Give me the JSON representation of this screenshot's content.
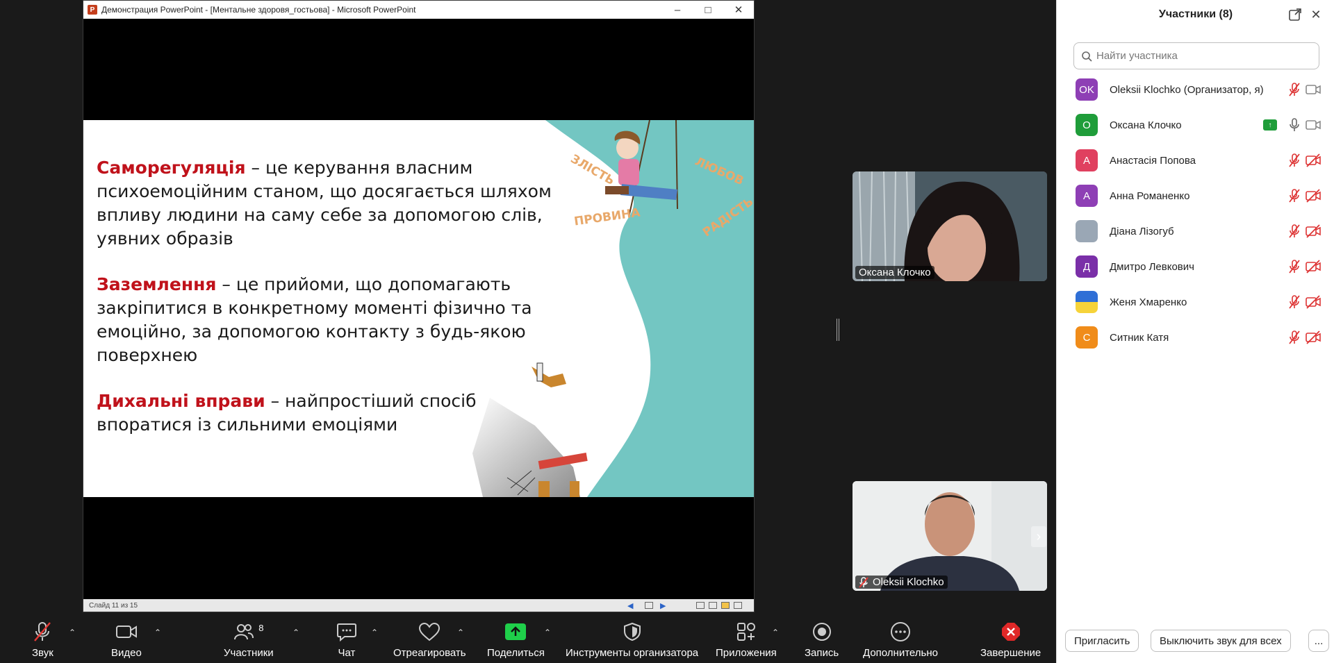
{
  "powerpoint": {
    "title": "Демонстрация PowerPoint - [Ментальне здоровя_гостьова] - Microsoft PowerPoint",
    "app_letter": "P",
    "status": "Слайд 11 из 15",
    "slide": {
      "p1_term": "Саморегуляція",
      "p1_rest": " – це керування власним психоемоційним  станом, що досягається шляхом впливу людини на саму себе за допомогою слів, уявних образів",
      "p2_term": "Заземлення",
      "p2_rest": " – це прийоми, що допомагають закріпитися в конкретному моменті фізично та емоційно, за допомогою контакту з будь-якою поверхнею",
      "p3_term": "Дихальні вправи",
      "p3_rest": " – найпростіший спосіб впоратися із сильними емоціями",
      "emotion_words": [
        "ЗЛІСТЬ",
        "ЛЮБОВ",
        "ПРОВИНА",
        "РАДІСТЬ"
      ]
    }
  },
  "videos": [
    {
      "name": "Оксана Клочко",
      "muted": false
    },
    {
      "name": "Oleksii Klochko",
      "muted": true
    }
  ],
  "toolbar": {
    "audio": "Звук",
    "video": "Видео",
    "participants": "Участники",
    "participants_count": "8",
    "chat": "Чат",
    "react": "Отреагировать",
    "share": "Поделиться",
    "host_tools": "Инструменты организатора",
    "apps": "Приложения",
    "record": "Запись",
    "more": "Дополнительно",
    "end": "Завершение"
  },
  "panel": {
    "title": "Участники (8)",
    "search_placeholder": "Найти участника",
    "participants": [
      {
        "initials": "OK",
        "name": "Oleksii Klochko (Организатор, я)",
        "color": "#8e3fb5"
      },
      {
        "initials": "О",
        "name": "Оксана Клочко",
        "color": "#1f9d3a",
        "sharing": true
      },
      {
        "initials": "А",
        "name": "Анастасія Попова",
        "color": "#e0405f"
      },
      {
        "initials": "А",
        "name": "Анна Романенко",
        "color": "#8e3fb5"
      },
      {
        "initials": "",
        "name": "Діана Лізогуб",
        "color": "#9aa7b5"
      },
      {
        "initials": "Д",
        "name": "Дмитро Левкович",
        "color": "#7a2fa8"
      },
      {
        "initials": "",
        "name": "Женя Хмаренко",
        "color": "#2f6fd6"
      },
      {
        "initials": "С",
        "name": "Ситник Катя",
        "color": "#f08c1a"
      }
    ],
    "invite": "Пригласить",
    "mute_all": "Выключить звук для всех",
    "more": "..."
  }
}
